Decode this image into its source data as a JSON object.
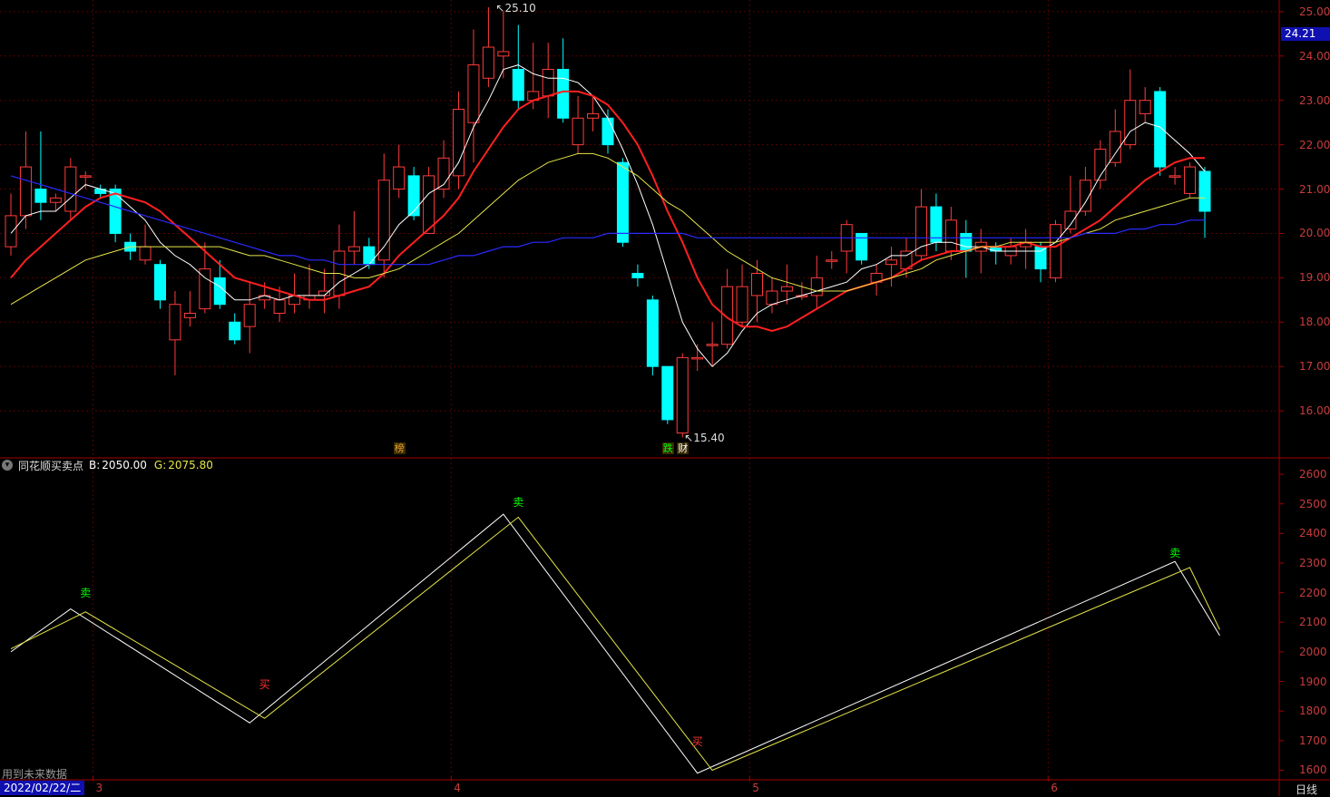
{
  "indicator": {
    "name": "同花顺买卖点",
    "b_label": "B:",
    "b_value": "2050.00",
    "g_label": "G:",
    "g_value": "2075.80"
  },
  "current_price": "24.21",
  "footer_note": "用到未来数据",
  "date_box": "2022/02/22/二",
  "period_label": "日线",
  "event_tags": [
    {
      "text": "榜",
      "bar": 26
    },
    {
      "text": "跌",
      "bar": 44
    },
    {
      "text": "财",
      "bar": 45
    }
  ],
  "month_ticks": [
    {
      "text": "3",
      "bar": 5.5
    },
    {
      "text": "4",
      "bar": 29.5
    },
    {
      "text": "5",
      "bar": 49.5
    },
    {
      "text": "6",
      "bar": 69.5
    }
  ],
  "colors": {
    "up": "#ff3b3b",
    "down": "#00ffff",
    "ma5": "#ffffff",
    "ma10": "#ff2020",
    "ma20": "#e6e64a",
    "ma60": "#2a2aff",
    "axis": "#a00000",
    "buy": "#ff3030",
    "sell": "#00ff00"
  },
  "chart_data": [
    {
      "type": "candlestick",
      "title": "",
      "ylim": [
        15.0,
        25.1
      ],
      "yticks": [
        "16.00",
        "17.00",
        "18.00",
        "19.00",
        "20.00",
        "21.00",
        "22.00",
        "23.00",
        "24.00",
        "25.00"
      ],
      "high_label": "25.10",
      "low_label": "15.40",
      "candles": [
        [
          19.7,
          20.4,
          20.9,
          19.5
        ],
        [
          20.4,
          21.5,
          22.3,
          20.1
        ],
        [
          21.0,
          20.7,
          22.3,
          20.3
        ],
        [
          20.7,
          20.8,
          20.9,
          20.5
        ],
        [
          20.5,
          21.5,
          21.7,
          20.3
        ],
        [
          21.3,
          21.3,
          21.4,
          21.0
        ],
        [
          21.0,
          20.9,
          21.1,
          20.8
        ],
        [
          21.0,
          20.0,
          21.1,
          19.8
        ],
        [
          19.8,
          19.6,
          20.0,
          19.4
        ],
        [
          19.4,
          19.7,
          20.2,
          19.3
        ],
        [
          19.3,
          18.5,
          19.4,
          18.3
        ],
        [
          17.6,
          18.4,
          18.7,
          16.8
        ],
        [
          18.1,
          18.2,
          18.7,
          17.9
        ],
        [
          18.3,
          19.2,
          19.8,
          18.2
        ],
        [
          19.0,
          18.4,
          19.4,
          18.3
        ],
        [
          18.0,
          17.6,
          18.2,
          17.5
        ],
        [
          17.9,
          18.4,
          18.9,
          17.3
        ],
        [
          18.5,
          18.6,
          18.9,
          18.3
        ],
        [
          18.2,
          18.5,
          18.8,
          18.0
        ],
        [
          18.4,
          18.6,
          19.1,
          18.2
        ],
        [
          18.5,
          18.6,
          19.3,
          18.3
        ],
        [
          18.6,
          18.7,
          19.2,
          18.2
        ],
        [
          18.6,
          19.6,
          20.2,
          18.3
        ],
        [
          19.6,
          19.7,
          20.5,
          19.3
        ],
        [
          19.7,
          19.3,
          19.9,
          19.2
        ],
        [
          19.4,
          21.2,
          21.8,
          19.0
        ],
        [
          21.0,
          21.5,
          22.0,
          20.8
        ],
        [
          21.3,
          20.4,
          21.5,
          20.3
        ],
        [
          20.0,
          21.3,
          21.5,
          20.0
        ],
        [
          21.0,
          21.7,
          22.1,
          20.8
        ],
        [
          21.3,
          22.8,
          23.2,
          21.0
        ],
        [
          22.5,
          23.8,
          24.6,
          21.6
        ],
        [
          23.5,
          24.2,
          25.1,
          23.3
        ],
        [
          24.0,
          24.1,
          25.0,
          23.5
        ],
        [
          23.7,
          23.0,
          24.7,
          22.8
        ],
        [
          23.0,
          23.2,
          24.3,
          22.8
        ],
        [
          23.1,
          23.7,
          24.3,
          22.6
        ],
        [
          23.7,
          22.6,
          24.4,
          22.5
        ],
        [
          22.0,
          22.6,
          23.1,
          21.8
        ],
        [
          22.6,
          22.7,
          23.1,
          22.3
        ],
        [
          22.6,
          22.0,
          22.8,
          21.8
        ],
        [
          21.6,
          19.8,
          21.7,
          19.7
        ],
        [
          19.1,
          19.0,
          19.3,
          18.8
        ],
        [
          18.5,
          17.0,
          18.6,
          16.8
        ],
        [
          17.0,
          15.8,
          17.0,
          15.7
        ],
        [
          15.5,
          17.2,
          17.3,
          15.4
        ],
        [
          17.2,
          17.2,
          17.5,
          16.9
        ],
        [
          17.5,
          17.5,
          18.0,
          17.0
        ],
        [
          17.5,
          18.8,
          19.2,
          17.4
        ],
        [
          18.0,
          18.8,
          19.3,
          17.9
        ],
        [
          18.6,
          19.1,
          19.4,
          18.0
        ],
        [
          18.4,
          18.7,
          19.0,
          18.2
        ],
        [
          18.7,
          18.8,
          19.3,
          18.4
        ],
        [
          18.6,
          18.6,
          18.9,
          18.5
        ],
        [
          18.6,
          19.0,
          19.5,
          18.3
        ],
        [
          19.4,
          19.4,
          19.6,
          19.2
        ],
        [
          19.6,
          20.2,
          20.3,
          19.1
        ],
        [
          20.0,
          19.4,
          20.0,
          19.3
        ],
        [
          18.9,
          19.1,
          19.3,
          18.6
        ],
        [
          19.3,
          19.4,
          19.7,
          18.8
        ],
        [
          19.2,
          19.6,
          19.9,
          19.0
        ],
        [
          19.5,
          20.6,
          21.0,
          19.4
        ],
        [
          20.6,
          19.8,
          20.9,
          19.6
        ],
        [
          19.6,
          20.3,
          20.6,
          19.4
        ],
        [
          20.0,
          19.6,
          20.3,
          19.0
        ],
        [
          19.6,
          19.8,
          20.1,
          19.1
        ],
        [
          19.7,
          19.6,
          19.8,
          19.3
        ],
        [
          19.5,
          19.7,
          19.9,
          19.3
        ],
        [
          19.7,
          19.8,
          20.1,
          19.2
        ],
        [
          19.7,
          19.2,
          19.8,
          18.9
        ],
        [
          19.0,
          20.2,
          20.3,
          18.9
        ],
        [
          20.1,
          20.5,
          21.3,
          20.0
        ],
        [
          20.5,
          21.2,
          21.5,
          20.4
        ],
        [
          21.2,
          21.9,
          22.1,
          21.0
        ],
        [
          21.6,
          22.3,
          22.8,
          21.5
        ],
        [
          22.0,
          23.0,
          23.7,
          21.9
        ],
        [
          22.7,
          23.0,
          23.3,
          22.5
        ],
        [
          23.2,
          21.5,
          23.3,
          21.3
        ],
        [
          21.3,
          21.3,
          21.5,
          21.1
        ],
        [
          20.9,
          21.5,
          21.6,
          20.8
        ],
        [
          21.4,
          20.5,
          21.5,
          19.9
        ]
      ],
      "series": [
        {
          "name": "MA5",
          "values": [
            20.0,
            20.4,
            20.5,
            20.5,
            20.8,
            21.1,
            21.0,
            20.9,
            20.6,
            20.3,
            19.8,
            19.5,
            19.3,
            19.0,
            18.8,
            18.5,
            18.5,
            18.6,
            18.5,
            18.6,
            18.6,
            18.6,
            18.9,
            19.1,
            19.3,
            19.7,
            20.2,
            20.5,
            20.9,
            21.1,
            21.6,
            22.4,
            23.0,
            23.7,
            23.8,
            23.6,
            23.5,
            23.5,
            23.4,
            23.1,
            22.6,
            21.9,
            21.1,
            20.2,
            19.1,
            18.0,
            17.4,
            17.0,
            17.3,
            17.8,
            18.2,
            18.4,
            18.5,
            18.6,
            18.7,
            18.8,
            18.9,
            19.2,
            19.3,
            19.5,
            19.5,
            19.7,
            19.8,
            19.8,
            19.7,
            19.7,
            19.6,
            19.6,
            19.6,
            19.6,
            19.8,
            20.2,
            20.7,
            21.3,
            21.8,
            22.3,
            22.5,
            22.4,
            22.1,
            21.8,
            21.4
          ]
        },
        {
          "name": "MA10",
          "values": [
            19.0,
            19.4,
            19.7,
            20.0,
            20.3,
            20.6,
            20.8,
            20.9,
            20.8,
            20.7,
            20.5,
            20.2,
            19.9,
            19.6,
            19.3,
            19.0,
            18.9,
            18.8,
            18.7,
            18.6,
            18.5,
            18.5,
            18.6,
            18.7,
            18.8,
            19.1,
            19.5,
            19.8,
            20.1,
            20.4,
            20.8,
            21.4,
            21.9,
            22.4,
            22.8,
            23.0,
            23.1,
            23.2,
            23.2,
            23.1,
            22.9,
            22.5,
            22.0,
            21.3,
            20.5,
            19.8,
            19.0,
            18.4,
            18.1,
            17.9,
            17.9,
            17.8,
            17.9,
            18.1,
            18.3,
            18.5,
            18.7,
            18.8,
            18.9,
            19.0,
            19.2,
            19.4,
            19.5,
            19.6,
            19.6,
            19.7,
            19.7,
            19.7,
            19.8,
            19.7,
            19.7,
            19.9,
            20.1,
            20.3,
            20.6,
            20.9,
            21.2,
            21.4,
            21.6,
            21.7,
            21.7
          ]
        },
        {
          "name": "MA20",
          "values": [
            18.4,
            18.6,
            18.8,
            19.0,
            19.2,
            19.4,
            19.5,
            19.6,
            19.7,
            19.7,
            19.7,
            19.7,
            19.7,
            19.7,
            19.7,
            19.6,
            19.5,
            19.5,
            19.4,
            19.3,
            19.2,
            19.1,
            19.1,
            19.0,
            19.0,
            19.1,
            19.2,
            19.4,
            19.6,
            19.8,
            20.0,
            20.3,
            20.6,
            20.9,
            21.2,
            21.4,
            21.6,
            21.7,
            21.8,
            21.8,
            21.7,
            21.5,
            21.3,
            21.0,
            20.7,
            20.5,
            20.2,
            19.9,
            19.6,
            19.4,
            19.2,
            19.0,
            18.9,
            18.8,
            18.7,
            18.7,
            18.7,
            18.8,
            18.9,
            19.0,
            19.1,
            19.2,
            19.4,
            19.5,
            19.6,
            19.7,
            19.7,
            19.8,
            19.8,
            19.8,
            19.8,
            19.9,
            20.0,
            20.1,
            20.3,
            20.4,
            20.5,
            20.6,
            20.7,
            20.8,
            20.8
          ]
        },
        {
          "name": "MA60",
          "values": [
            21.3,
            21.2,
            21.1,
            21.0,
            20.9,
            20.8,
            20.7,
            20.6,
            20.5,
            20.4,
            20.3,
            20.2,
            20.1,
            20.0,
            19.9,
            19.8,
            19.7,
            19.6,
            19.5,
            19.5,
            19.4,
            19.4,
            19.3,
            19.3,
            19.3,
            19.3,
            19.3,
            19.3,
            19.3,
            19.4,
            19.5,
            19.5,
            19.6,
            19.7,
            19.7,
            19.8,
            19.8,
            19.9,
            19.9,
            19.9,
            20.0,
            20.0,
            20.0,
            20.0,
            20.0,
            20.0,
            19.9,
            19.9,
            19.9,
            19.9,
            19.9,
            19.9,
            19.9,
            19.9,
            19.9,
            19.9,
            19.9,
            19.9,
            19.9,
            19.9,
            19.9,
            19.9,
            19.9,
            19.9,
            19.9,
            19.9,
            19.9,
            19.9,
            19.9,
            19.9,
            19.9,
            19.9,
            20.0,
            20.0,
            20.0,
            20.1,
            20.1,
            20.2,
            20.2,
            20.3,
            20.3
          ]
        }
      ]
    },
    {
      "type": "line",
      "title": "同花顺买卖点",
      "ylim": [
        1580,
        2640
      ],
      "yticks": [
        "1600",
        "1700",
        "1800",
        "1900",
        "2000",
        "2100",
        "2200",
        "2300",
        "2400",
        "2500",
        "2600"
      ],
      "series": [
        {
          "name": "B",
          "x": [
            0,
            4,
            16,
            33,
            46,
            78,
            81
          ],
          "values": [
            2000,
            2145,
            1760,
            2465,
            1590,
            2305,
            2055
          ]
        },
        {
          "name": "G",
          "x": [
            0,
            5,
            17,
            34,
            47,
            79,
            81
          ],
          "values": [
            2010,
            2135,
            1775,
            2455,
            1600,
            2285,
            2075
          ]
        }
      ],
      "signals": [
        {
          "text": "卖",
          "bar": 5,
          "value": 2200,
          "type": "sell"
        },
        {
          "text": "买",
          "bar": 17,
          "value": 1890,
          "type": "buy"
        },
        {
          "text": "卖",
          "bar": 34,
          "value": 2505,
          "type": "sell"
        },
        {
          "text": "买",
          "bar": 46,
          "value": 1695,
          "type": "buy"
        },
        {
          "text": "卖",
          "bar": 78,
          "value": 2335,
          "type": "sell"
        }
      ]
    }
  ]
}
